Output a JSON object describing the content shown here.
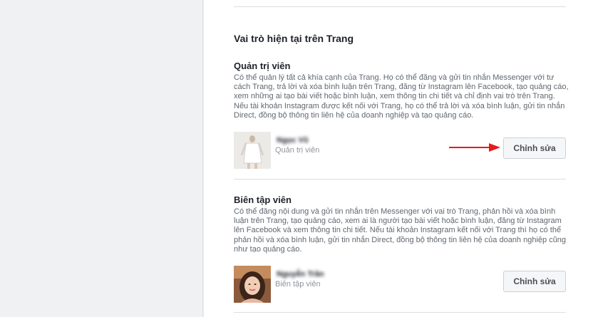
{
  "section": {
    "title": "Vai trò hiện tại trên Trang"
  },
  "roles": [
    {
      "title": "Quản trị viên",
      "description": [
        "Có thể quản lý tất cả khía cạnh của Trang. Họ có thể đăng và gửi tin nhắn Messenger với tư",
        "cách Trang, trả lời và xóa bình luận trên Trang, đăng từ Instagram lên Facebook, tạo quảng cáo,",
        "xem những ai tạo bài viết hoặc bình luận, xem thông tin chi tiết và chỉ định vai trò trên Trang.",
        "Nếu tài khoản Instagram được kết nối với Trang, họ có thể trả lời và xóa bình luận, gửi tin nhắn",
        "Direct, đồng bộ thông tin liên hệ của doanh nghiệp và tạo quảng cáo."
      ],
      "user": {
        "name": "Ngọc Vũ",
        "role_label": "Quản trị viên"
      },
      "edit_label": "Chỉnh sửa"
    },
    {
      "title": "Biên tập viên",
      "description": [
        "Có thể đăng nội dung và gửi tin nhắn trên Messenger với vai trò Trang, phản hồi và xóa bình",
        "luận trên Trang, tạo quảng cáo, xem ai là người tạo bài viết hoặc bình luận, đăng từ Instagram",
        "lên Facebook và xem thông tin chi tiết. Nếu tài khoản Instagram kết nối với Trang thì họ có thể",
        "phản hồi và xóa bình luận, gửi tin nhắn Direct, đồng bộ thông tin liên hệ của doanh nghiệp cũng",
        "như tạo quảng cáo."
      ],
      "user": {
        "name": "Nguyễn Trần",
        "role_label": "Biên tập viên"
      },
      "edit_label": "Chỉnh sửa"
    }
  ],
  "colors": {
    "annotation_arrow": "#e8191a"
  }
}
